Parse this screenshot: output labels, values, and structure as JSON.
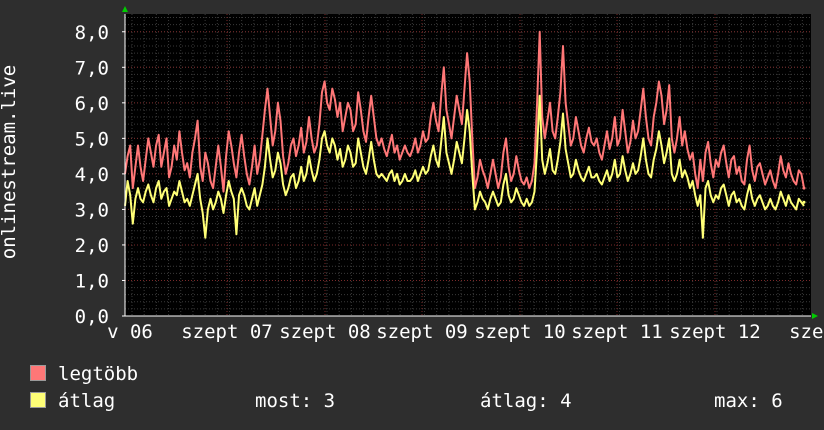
{
  "chart_data": {
    "type": "line",
    "ylabel": "onlinestream.live",
    "ylim": [
      0,
      8.5
    ],
    "y_ticks": [
      "0,0",
      "1,0",
      "2,0",
      "3,0",
      "4,0",
      "5,0",
      "6,0",
      "7,0",
      "8,0"
    ],
    "x_ticks": [
      "v 06",
      "szept 07",
      "szept 08",
      "szept 09",
      "szept 10",
      "szept 11",
      "szept 12",
      "szep"
    ],
    "grid": true,
    "series": [
      {
        "name": "legtöbb",
        "color": "#ff7777",
        "values": [
          4.0,
          4.5,
          4.8,
          3.6,
          4.2,
          4.8,
          4.2,
          3.8,
          4.4,
          5.0,
          4.6,
          4.2,
          4.8,
          5.1,
          4.2,
          4.6,
          5.0,
          3.9,
          4.2,
          4.8,
          4.4,
          5.2,
          4.6,
          4.1,
          4.3,
          3.9,
          4.6,
          5.0,
          5.5,
          4.2,
          3.8,
          4.6,
          4.3,
          3.8,
          3.6,
          4.2,
          4.8,
          4.2,
          3.5,
          4.5,
          5.2,
          4.8,
          4.3,
          3.9,
          4.6,
          5.1,
          4.5,
          4.0,
          3.7,
          4.2,
          4.8,
          4.0,
          4.4,
          5.1,
          5.8,
          6.4,
          5.6,
          4.8,
          5.2,
          6.0,
          5.5,
          4.5,
          4.0,
          4.3,
          4.8,
          5.0,
          4.5,
          4.8,
          5.3,
          4.6,
          4.9,
          5.6,
          5.0,
          4.6,
          4.8,
          5.4,
          6.3,
          6.6,
          6.0,
          5.8,
          6.4,
          6.1,
          5.6,
          6.0,
          5.2,
          5.6,
          6.0,
          5.8,
          5.2,
          5.4,
          6.3,
          5.8,
          5.2,
          4.9,
          5.6,
          6.2,
          5.6,
          5.0,
          4.8,
          5.0,
          4.7,
          4.5,
          4.8,
          5.1,
          4.6,
          4.8,
          4.4,
          4.6,
          4.8,
          4.6,
          4.5,
          4.7,
          5.0,
          4.6,
          4.8,
          5.2,
          4.9,
          5.0,
          5.6,
          6.0,
          5.5,
          5.2,
          6.2,
          7.0,
          5.8,
          5.4,
          5.0,
          5.6,
          6.2,
          5.8,
          5.4,
          6.4,
          7.4,
          6.6,
          5.0,
          3.6,
          3.9,
          4.4,
          4.1,
          3.9,
          3.6,
          4.0,
          4.4,
          4.0,
          3.6,
          3.9,
          4.6,
          5.0,
          4.2,
          3.8,
          4.0,
          4.5,
          4.1,
          3.8,
          3.7,
          3.9,
          3.6,
          3.8,
          4.3,
          6.0,
          8.0,
          5.6,
          5.0,
          5.5,
          6.0,
          5.2,
          5.0,
          5.6,
          6.3,
          7.6,
          6.0,
          5.4,
          4.8,
          5.0,
          5.6,
          5.2,
          4.8,
          4.6,
          5.0,
          5.3,
          4.9,
          4.8,
          5.0,
          4.6,
          4.4,
          4.8,
          5.2,
          4.7,
          5.0,
          5.6,
          4.8,
          5.0,
          5.8,
          5.2,
          4.6,
          4.9,
          5.5,
          5.0,
          5.2,
          5.8,
          6.4,
          5.6,
          5.0,
          4.8,
          5.6,
          6.0,
          6.6,
          6.2,
          5.4,
          5.8,
          6.5,
          5.0,
          4.6,
          5.0,
          5.6,
          4.8,
          5.2,
          4.7,
          4.4,
          4.6,
          4.0,
          3.6,
          4.4,
          3.8,
          4.6,
          4.9,
          4.3,
          3.9,
          4.4,
          4.2,
          4.6,
          4.8,
          4.3,
          3.9,
          4.4,
          4.5,
          4.0,
          4.2,
          3.8,
          3.7,
          4.4,
          4.8,
          4.1,
          3.8,
          4.2,
          4.3,
          4.0,
          3.7,
          3.9,
          4.1,
          3.8,
          3.6,
          4.0,
          4.5,
          4.1,
          3.9,
          4.3,
          4.0,
          3.8,
          3.7,
          4.1,
          4.0,
          3.6
        ],
        "final": 3.6
      },
      {
        "name": "átlag",
        "color": "#ffff77",
        "values": [
          3.1,
          3.8,
          3.4,
          2.6,
          3.3,
          3.6,
          3.3,
          3.2,
          3.5,
          3.7,
          3.4,
          3.2,
          3.6,
          3.8,
          3.3,
          3.5,
          3.6,
          3.1,
          3.3,
          3.5,
          3.4,
          3.8,
          3.5,
          3.2,
          3.3,
          3.1,
          3.4,
          3.7,
          4.0,
          3.3,
          2.9,
          2.2,
          3.0,
          3.3,
          3.0,
          3.2,
          3.5,
          3.3,
          2.9,
          3.4,
          3.8,
          3.5,
          3.3,
          2.3,
          3.4,
          3.6,
          3.4,
          3.1,
          3.0,
          3.3,
          3.6,
          3.1,
          3.4,
          3.7,
          4.2,
          5.0,
          4.4,
          3.9,
          4.1,
          4.6,
          4.3,
          3.7,
          3.4,
          3.6,
          3.9,
          4.0,
          3.6,
          3.8,
          4.2,
          3.8,
          4.0,
          4.5,
          4.1,
          3.8,
          4.0,
          4.4,
          5.0,
          5.2,
          4.8,
          4.6,
          5.0,
          4.8,
          4.4,
          4.7,
          4.2,
          4.4,
          4.8,
          4.6,
          4.2,
          4.3,
          5.0,
          4.6,
          4.2,
          4.0,
          4.4,
          4.9,
          4.4,
          4.0,
          3.9,
          4.0,
          3.9,
          3.8,
          4.0,
          4.1,
          3.8,
          4.0,
          3.7,
          3.8,
          4.0,
          3.8,
          3.8,
          3.9,
          4.1,
          3.8,
          4.0,
          4.2,
          4.0,
          4.1,
          4.5,
          4.8,
          4.4,
          4.2,
          4.9,
          5.6,
          4.6,
          4.3,
          4.0,
          4.4,
          4.9,
          4.6,
          4.3,
          5.0,
          5.8,
          5.2,
          4.0,
          3.0,
          3.2,
          3.5,
          3.3,
          3.2,
          3.0,
          3.3,
          3.5,
          3.3,
          3.1,
          3.2,
          3.7,
          4.0,
          3.4,
          3.2,
          3.3,
          3.6,
          3.4,
          3.2,
          3.1,
          3.3,
          3.1,
          3.2,
          3.5,
          4.7,
          6.2,
          4.4,
          4.0,
          4.3,
          4.7,
          4.1,
          4.0,
          4.4,
          4.9,
          5.7,
          4.7,
          4.3,
          3.9,
          4.0,
          4.4,
          4.1,
          3.9,
          3.8,
          4.0,
          4.2,
          3.9,
          3.9,
          4.0,
          3.8,
          3.7,
          3.9,
          4.1,
          3.8,
          4.0,
          4.4,
          3.9,
          4.0,
          4.5,
          4.1,
          3.8,
          4.0,
          4.3,
          4.0,
          4.1,
          4.5,
          5.0,
          4.4,
          4.0,
          3.9,
          4.4,
          4.7,
          5.2,
          4.8,
          4.3,
          4.6,
          5.0,
          4.0,
          3.8,
          4.0,
          4.4,
          3.9,
          4.1,
          3.9,
          3.6,
          3.8,
          3.4,
          3.1,
          3.4,
          2.2,
          3.6,
          3.8,
          3.4,
          3.2,
          3.4,
          3.3,
          3.6,
          3.7,
          3.4,
          3.1,
          3.4,
          3.5,
          3.2,
          3.3,
          3.1,
          3.0,
          3.4,
          3.7,
          3.3,
          3.1,
          3.3,
          3.4,
          3.2,
          3.0,
          3.1,
          3.3,
          3.1,
          3.0,
          3.2,
          3.5,
          3.3,
          3.1,
          3.4,
          3.2,
          3.1,
          3.0,
          3.3,
          3.2,
          3.1
        ],
        "final": 3.2
      }
    ]
  },
  "legend": {
    "items": [
      {
        "label": "legtöbb",
        "color": "#ff7777"
      },
      {
        "label": "átlag",
        "color": "#ffff77"
      }
    ]
  },
  "stats": {
    "most": "most: 3",
    "atlag": "átlag: 4",
    "max": "max: 6"
  },
  "colors": {
    "background": "#2e2e2e",
    "plot_background": "#000000",
    "grid_major": "#7a2a2a",
    "grid_minor": "#3a3a3a",
    "axis": "#ffffff",
    "axis_arrow": "#00cc00"
  }
}
